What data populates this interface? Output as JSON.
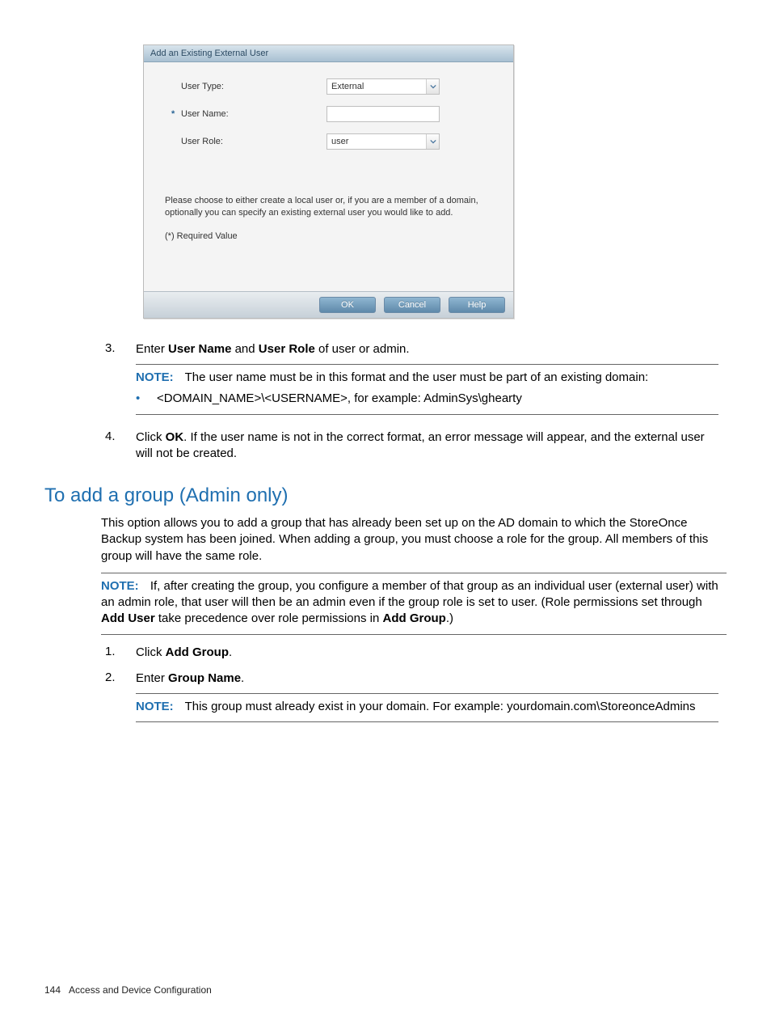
{
  "dialog": {
    "title": "Add an Existing External User",
    "user_type_label": "User Type:",
    "user_type_value": "External",
    "user_name_label": "User Name:",
    "user_name_value": "",
    "user_role_label": "User Role:",
    "user_role_value": "user",
    "instruction": "Please choose to either create a local user or, if you are a member of a domain, optionally you can specify an existing external user you would like to add.",
    "required_legend": "(*) Required Value",
    "ok": "OK",
    "cancel": "Cancel",
    "help": "Help"
  },
  "step3": {
    "num": "3.",
    "text_a": "Enter ",
    "text_b": "User Name",
    "text_c": " and ",
    "text_d": "User Role",
    "text_e": " of user or admin.",
    "note_label": "NOTE:",
    "note_text": "The user name must be in this format and the user must be part of an existing domain:",
    "bullet": "<DOMAIN_NAME>\\<USERNAME>, for example: AdminSys\\ghearty"
  },
  "step4": {
    "num": "4.",
    "text_a": "Click ",
    "text_b": "OK",
    "text_c": ". If the user name is not in the correct format, an error message will appear, and the external user will not be created."
  },
  "heading": "To add a group (Admin only)",
  "group_intro": "This option allows you to add a group that has already been set up on the AD domain to which the StoreOnce Backup system has been joined. When adding a group, you must choose a role for the group. All members of this group will have the same role.",
  "group_note": {
    "label": "NOTE:",
    "text_a": "If, after creating the group, you configure a member of that group as an individual user (external user) with an admin role, that user will then be an admin even if the group role is set to user. (Role permissions set through ",
    "text_b": "Add User",
    "text_c": " take precedence over role permissions in ",
    "text_d": "Add Group",
    "text_e": ".)"
  },
  "gstep1": {
    "num": "1.",
    "a": "Click ",
    "b": "Add Group",
    "c": "."
  },
  "gstep2": {
    "num": "2.",
    "a": "Enter ",
    "b": "Group Name",
    "c": ".",
    "note_label": "NOTE:",
    "note_text": "This group must already exist in your domain. For example: yourdomain.com\\StoreonceAdmins"
  },
  "footer": {
    "page": "144",
    "section": "Access and Device Configuration"
  }
}
